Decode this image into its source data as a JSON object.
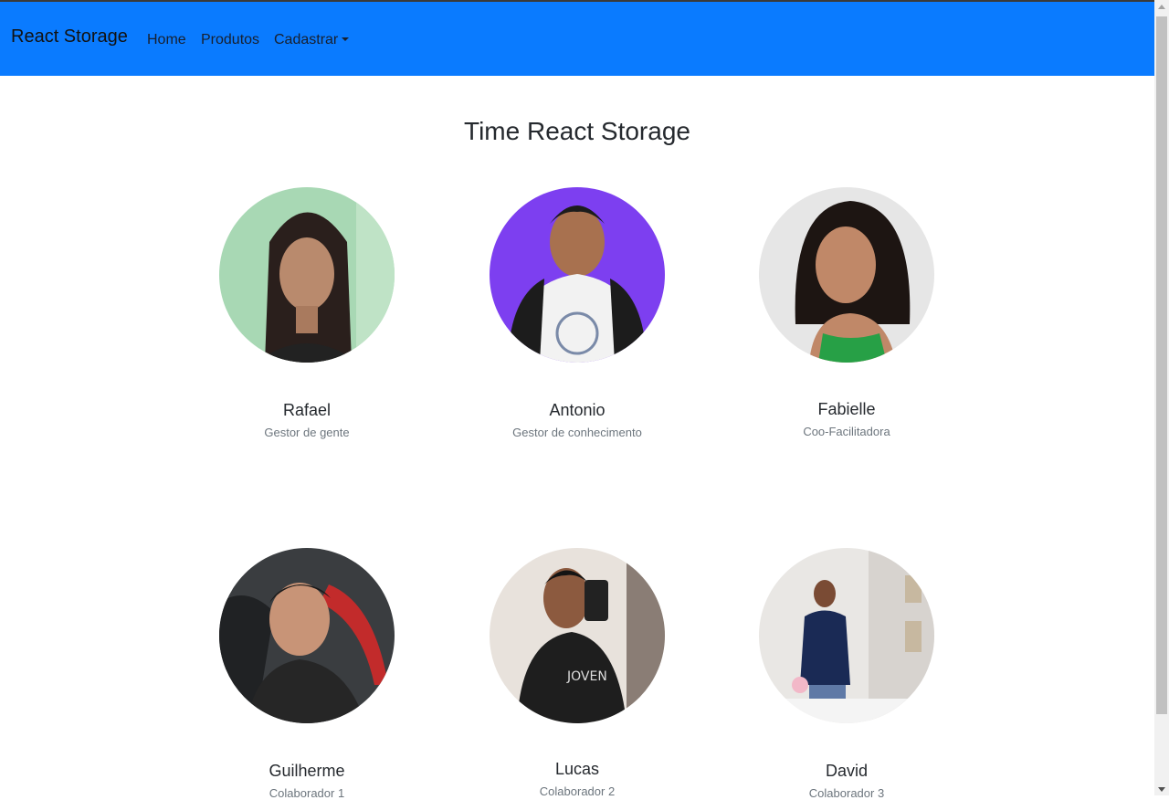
{
  "navbar": {
    "brand": "React Storage",
    "links": [
      "Home",
      "Produtos",
      "Cadastrar"
    ]
  },
  "page_title": "Time React Storage",
  "team": [
    {
      "name": "Rafael",
      "role": "Gestor de gente"
    },
    {
      "name": "Antonio",
      "role": "Gestor de conhecimento"
    },
    {
      "name": "Fabielle",
      "role": "Coo-Facilitadora"
    },
    {
      "name": "Guilherme",
      "role": "Colaborador 1"
    },
    {
      "name": "Lucas",
      "role": "Colaborador 2"
    },
    {
      "name": "David",
      "role": "Colaborador 3"
    }
  ],
  "colors": {
    "navbar": "#0a7bff",
    "role_text": "#6c757d"
  }
}
